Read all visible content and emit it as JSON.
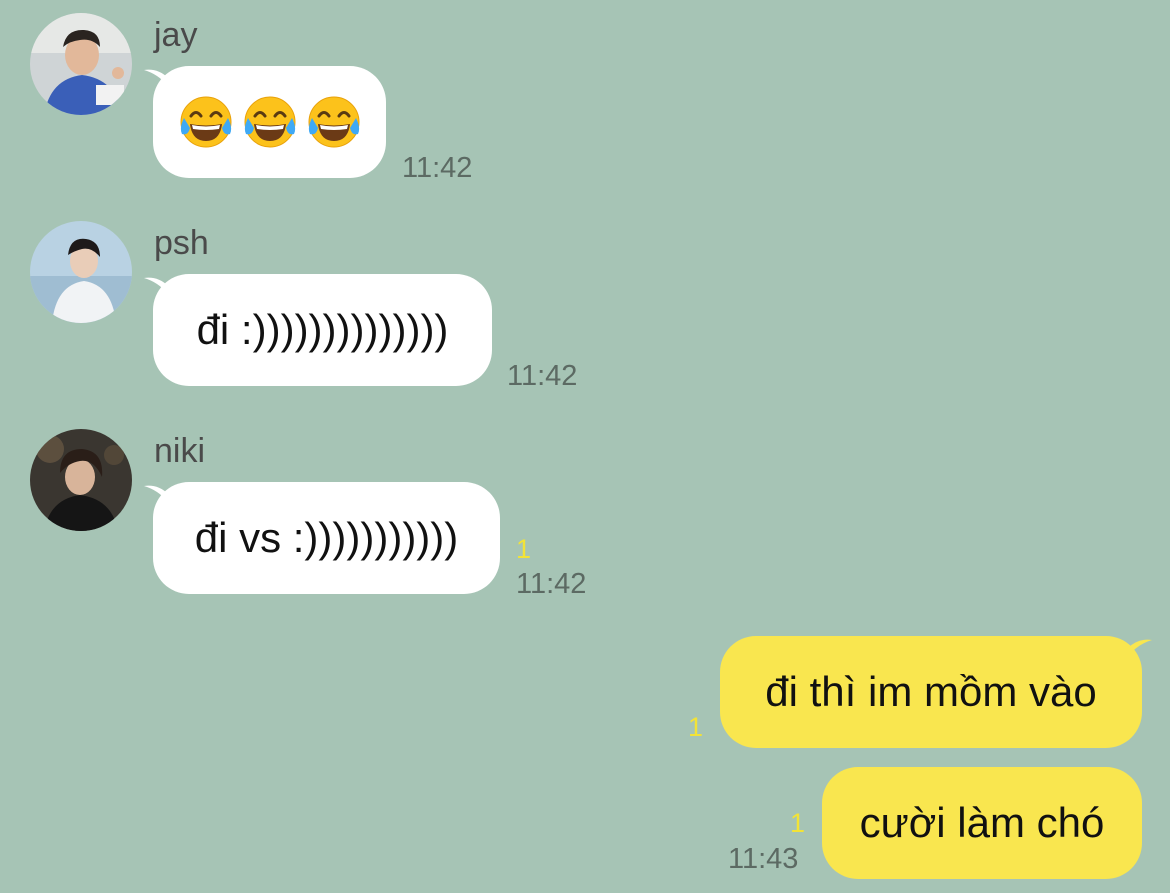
{
  "colors": {
    "background": "#a6c4b5",
    "incoming_bubble": "#ffffff",
    "outgoing_bubble": "#f9e64f",
    "unread_count": "#f2e337",
    "timestamp": "#5c6a63"
  },
  "messages": [
    {
      "sender": "jay",
      "avatar_icon": "profile-photo",
      "content_icons": [
        "tears-of-joy-emoji",
        "tears-of-joy-emoji",
        "tears-of-joy-emoji"
      ],
      "time": "11:42"
    },
    {
      "sender": "psh",
      "avatar_icon": "profile-photo",
      "text": "đi :))))))))))))))",
      "time": "11:42"
    },
    {
      "sender": "niki",
      "avatar_icon": "profile-photo",
      "text": "đi vs :)))))))))))",
      "unread": "1",
      "time": "11:42"
    },
    {
      "outgoing": true,
      "text": "đi thì im mồm vào",
      "unread": "1"
    },
    {
      "outgoing": true,
      "text": "cười làm chó",
      "unread": "1",
      "time": "11:43"
    }
  ]
}
